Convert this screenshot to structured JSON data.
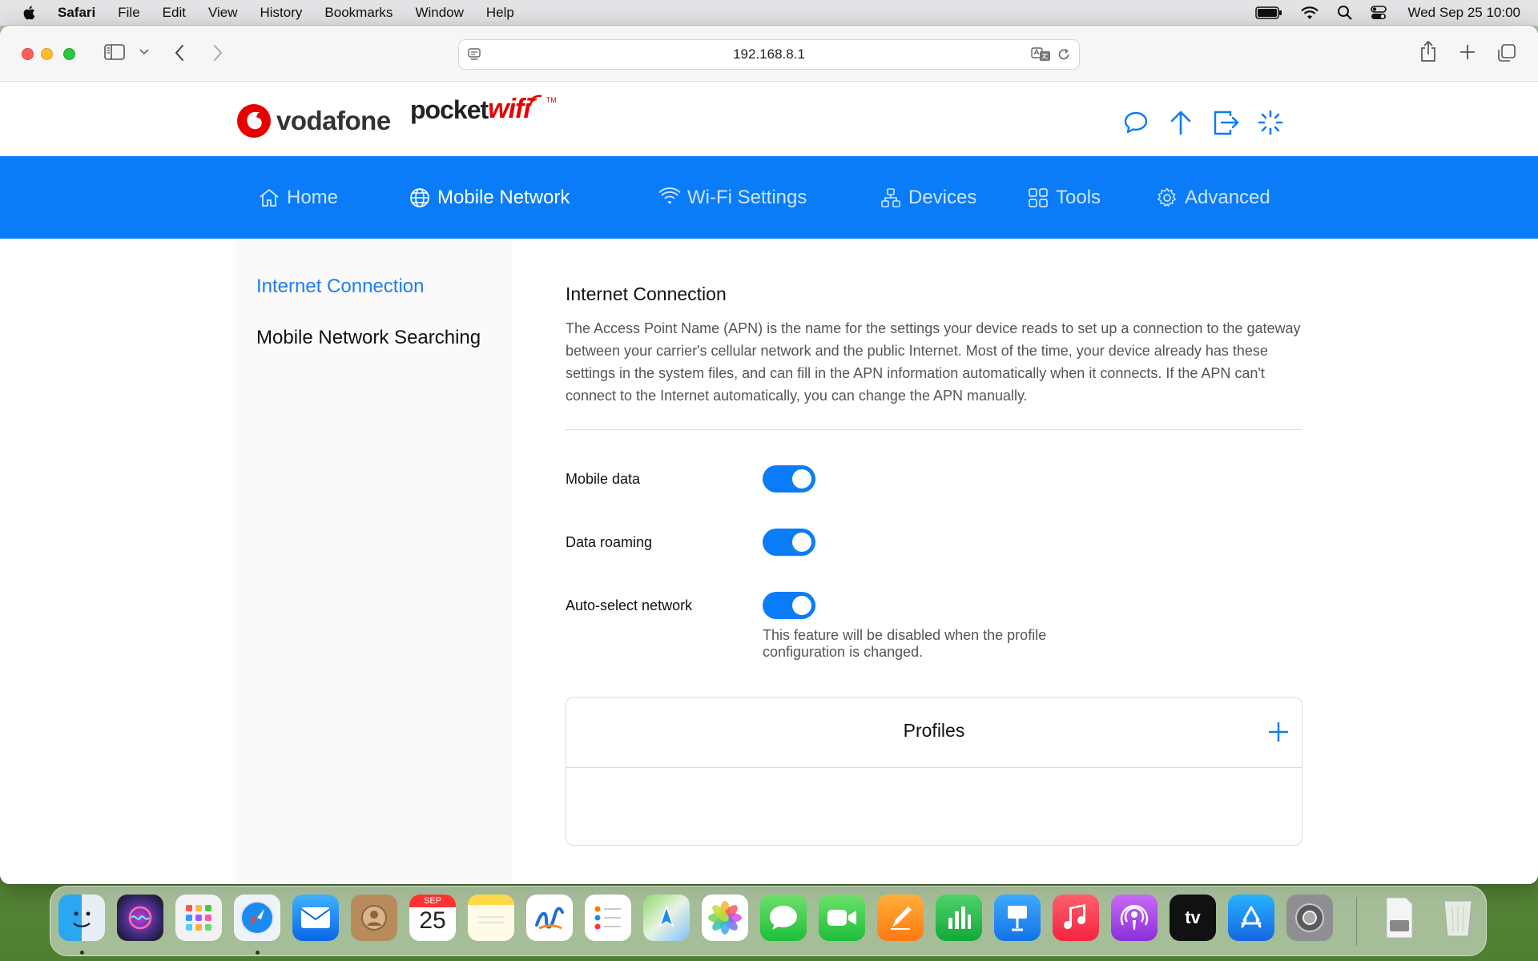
{
  "menubar": {
    "app_name": "Safari",
    "items": [
      "File",
      "Edit",
      "View",
      "History",
      "Bookmarks",
      "Window",
      "Help"
    ],
    "datetime": "Wed Sep 25  10:00"
  },
  "browser": {
    "url": "192.168.8.1"
  },
  "brand": {
    "vodafone": "vodafone",
    "pocket": "pocket",
    "wifi": "wifi",
    "tm": "TM",
    "accent_color": "#e60000"
  },
  "nav": {
    "color": "#0a7cf7",
    "items": [
      {
        "label": "Home"
      },
      {
        "label": "Mobile Network"
      },
      {
        "label": "Wi-Fi Settings"
      },
      {
        "label": "Devices"
      },
      {
        "label": "Tools"
      },
      {
        "label": "Advanced"
      }
    ]
  },
  "sidebar": {
    "items": [
      {
        "label": "Internet Connection"
      },
      {
        "label": "Mobile Network Searching"
      }
    ]
  },
  "content": {
    "title": "Internet Connection",
    "description": "The Access Point Name (APN) is the name for the settings your device reads to set up a connection to the gateway between your carrier's cellular network and the public Internet. Most of the time, your device already has these settings in the system files, and can fill in the APN information automatically when it connects. If the APN can't connect to the Internet automatically, you can change the APN manually.",
    "settings": [
      {
        "label": "Mobile data",
        "enabled": true
      },
      {
        "label": "Data roaming",
        "enabled": true
      },
      {
        "label": "Auto-select network",
        "enabled": true
      }
    ],
    "auto_select_note": "This feature will be disabled when the profile configuration is changed.",
    "profiles_title": "Profiles"
  },
  "dock": {
    "calendar_month": "SEP",
    "calendar_day": "25",
    "tv_label": "tv"
  }
}
